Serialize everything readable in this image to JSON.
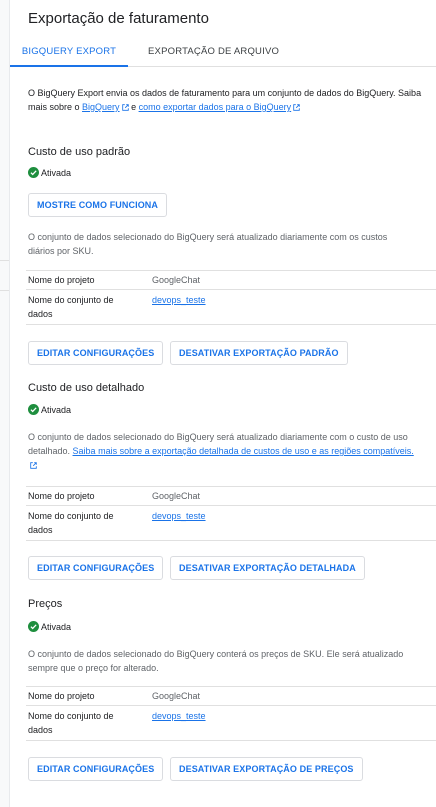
{
  "page": {
    "title": "Exportação de faturamento"
  },
  "tabs": [
    {
      "label": "BIGQUERY EXPORT",
      "active": true
    },
    {
      "label": "EXPORTAÇÃO DE ARQUIVO",
      "active": false
    }
  ],
  "intro": {
    "text1": "O BigQuery Export envia os dados de faturamento para um conjunto de dados do BigQuery. Saiba mais sobre o ",
    "link1": "BigQuery",
    "text2": " e ",
    "link2": "como exportar dados para o BigQuery"
  },
  "colors": {
    "accent": "#1a73e8",
    "success": "#1e8e3e"
  },
  "icons": {
    "status": "check-circle-icon",
    "external": "external-link-icon"
  },
  "sections": {
    "standard": {
      "title": "Custo de uso padrão",
      "status": "Ativada",
      "how_button": "MOSTRE COMO FUNCIONA",
      "description": "O conjunto de dados selecionado do BigQuery será atualizado diariamente com os custos diários por SKU.",
      "project_label": "Nome do projeto",
      "project_value": "GoogleChat",
      "dataset_label": "Nome do conjunto de dados",
      "dataset_value": "devops_teste",
      "edit_button": "EDITAR CONFIGURAÇÕES",
      "disable_button": "DESATIVAR EXPORTAÇÃO PADRÃO"
    },
    "detailed": {
      "title": "Custo de uso detalhado",
      "status": "Ativada",
      "description": "O conjunto de dados selecionado do BigQuery será atualizado diariamente com o custo de uso detalhado. ",
      "link": "Saiba mais sobre a exportação detalhada de custos de uso e as regiões compatíveis.",
      "project_label": "Nome do projeto",
      "project_value": "GoogleChat",
      "dataset_label": "Nome do conjunto de dados",
      "dataset_value": "devops_teste",
      "edit_button": "EDITAR CONFIGURAÇÕES",
      "disable_button": "DESATIVAR EXPORTAÇÃO DETALHADA"
    },
    "pricing": {
      "title": "Preços",
      "status": "Ativada",
      "description": "O conjunto de dados selecionado do BigQuery conterá os preços de SKU. Ele será atualizado sempre que o preço for alterado.",
      "project_label": "Nome do projeto",
      "project_value": "GoogleChat",
      "dataset_label": "Nome do conjunto de dados",
      "dataset_value": "devops_teste",
      "edit_button": "EDITAR CONFIGURAÇÕES",
      "disable_button": "DESATIVAR EXPORTAÇÃO DE PREÇOS"
    }
  }
}
